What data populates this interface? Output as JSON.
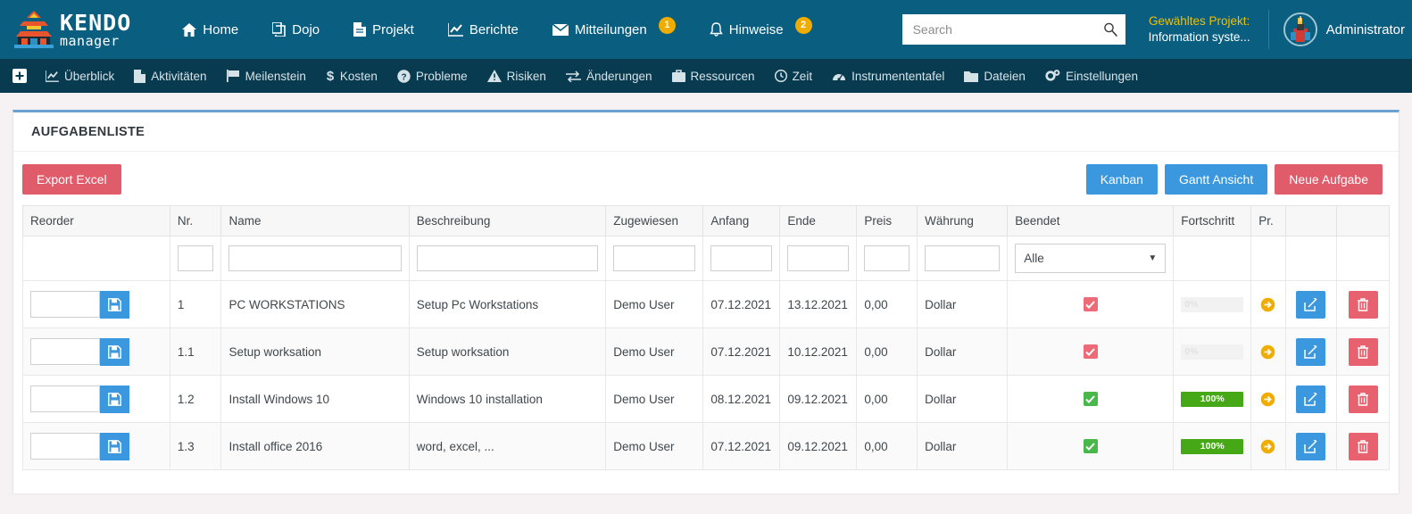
{
  "header": {
    "logo": {
      "line1": "KENDO",
      "line2": "manager",
      "icon": "pagoda-icon"
    },
    "nav": [
      {
        "label": "Home",
        "icon": "home-icon",
        "badge": null
      },
      {
        "label": "Dojo",
        "icon": "copy-icon",
        "badge": null
      },
      {
        "label": "Projekt",
        "icon": "file-icon",
        "badge": null
      },
      {
        "label": "Berichte",
        "icon": "chart-line-icon",
        "badge": null
      },
      {
        "label": "Mitteilungen",
        "icon": "envelope-icon",
        "badge": "1"
      },
      {
        "label": "Hinweise",
        "icon": "bell-icon",
        "badge": "2"
      }
    ],
    "search": {
      "placeholder": "Search",
      "value": "",
      "icon": "search-icon"
    },
    "project": {
      "label": "Gewähltes Projekt:",
      "name": "Information syste..."
    },
    "user": {
      "name": "Administrator",
      "avatar": "samurai-avatar"
    },
    "colors": {
      "topbar": "#0a5e80",
      "subnav": "#083b4f",
      "badge": "#f0ad00",
      "project_label": "#f0c000"
    }
  },
  "subnav": {
    "plus_icon": "plus-square-icon",
    "items": [
      {
        "label": "Überblick",
        "icon": "chart-line-icon"
      },
      {
        "label": "Aktivitäten",
        "icon": "files-icon"
      },
      {
        "label": "Meilenstein",
        "icon": "flag-icon"
      },
      {
        "label": "Kosten",
        "icon": "dollar-icon"
      },
      {
        "label": "Probleme",
        "icon": "question-circle-icon"
      },
      {
        "label": "Risiken",
        "icon": "warning-triangle-icon"
      },
      {
        "label": "Änderungen",
        "icon": "exchange-icon"
      },
      {
        "label": "Ressourcen",
        "icon": "briefcase-icon"
      },
      {
        "label": "Zeit",
        "icon": "clock-icon"
      },
      {
        "label": "Instrumententafel",
        "icon": "dashboard-icon"
      },
      {
        "label": "Dateien",
        "icon": "folder-icon"
      },
      {
        "label": "Einstellungen",
        "icon": "gears-icon"
      }
    ]
  },
  "panel": {
    "title": "AUFGABENLISTE",
    "toolbar": {
      "export_label": "Export Excel",
      "kanban_label": "Kanban",
      "gantt_label": "Gantt Ansicht",
      "new_task_label": "Neue Aufgabe"
    }
  },
  "table": {
    "columns": [
      "Reorder",
      "Nr.",
      "Name",
      "Beschreibung",
      "Zugewiesen",
      "Anfang",
      "Ende",
      "Preis",
      "Währung",
      "Beendet",
      "Fortschritt",
      "Pr.",
      "",
      ""
    ],
    "filters": {
      "nr": "",
      "name": "",
      "beschreibung": "",
      "zugewiesen": "",
      "anfang": "",
      "ende": "",
      "preis": "",
      "waehrung": "",
      "beendet_selected": "Alle"
    },
    "rows": [
      {
        "reorder": "",
        "nr": "1",
        "name": "PC WORKSTATIONS",
        "beschreibung": "Setup Pc Workstations",
        "zugewiesen": "Demo User",
        "anfang": "07.12.2021",
        "ende": "13.12.2021",
        "preis": "0,00",
        "waehrung": "Dollar",
        "beendet": "unchecked-red",
        "fortschritt": "0%"
      },
      {
        "reorder": "",
        "nr": "1.1",
        "name": "Setup worksation",
        "beschreibung": "Setup worksation",
        "zugewiesen": "Demo User",
        "anfang": "07.12.2021",
        "ende": "10.12.2021",
        "preis": "0,00",
        "waehrung": "Dollar",
        "beendet": "unchecked-red",
        "fortschritt": "0%"
      },
      {
        "reorder": "",
        "nr": "1.2",
        "name": "Install Windows 10",
        "beschreibung": "Windows 10 installation",
        "zugewiesen": "Demo User",
        "anfang": "08.12.2021",
        "ende": "09.12.2021",
        "preis": "0,00",
        "waehrung": "Dollar",
        "beendet": "checked-green",
        "fortschritt": "100%"
      },
      {
        "reorder": "",
        "nr": "1.3",
        "name": "Install office 2016",
        "beschreibung": "word, excel, ...",
        "zugewiesen": "Demo User",
        "anfang": "07.12.2021",
        "ende": "09.12.2021",
        "preis": "0,00",
        "waehrung": "Dollar",
        "beendet": "checked-green",
        "fortschritt": "100%"
      }
    ],
    "row_icons": {
      "save": "floppy-disk-icon",
      "promote": "arrow-circle-right-icon",
      "edit": "pencil-square-icon",
      "delete": "trash-icon"
    }
  }
}
